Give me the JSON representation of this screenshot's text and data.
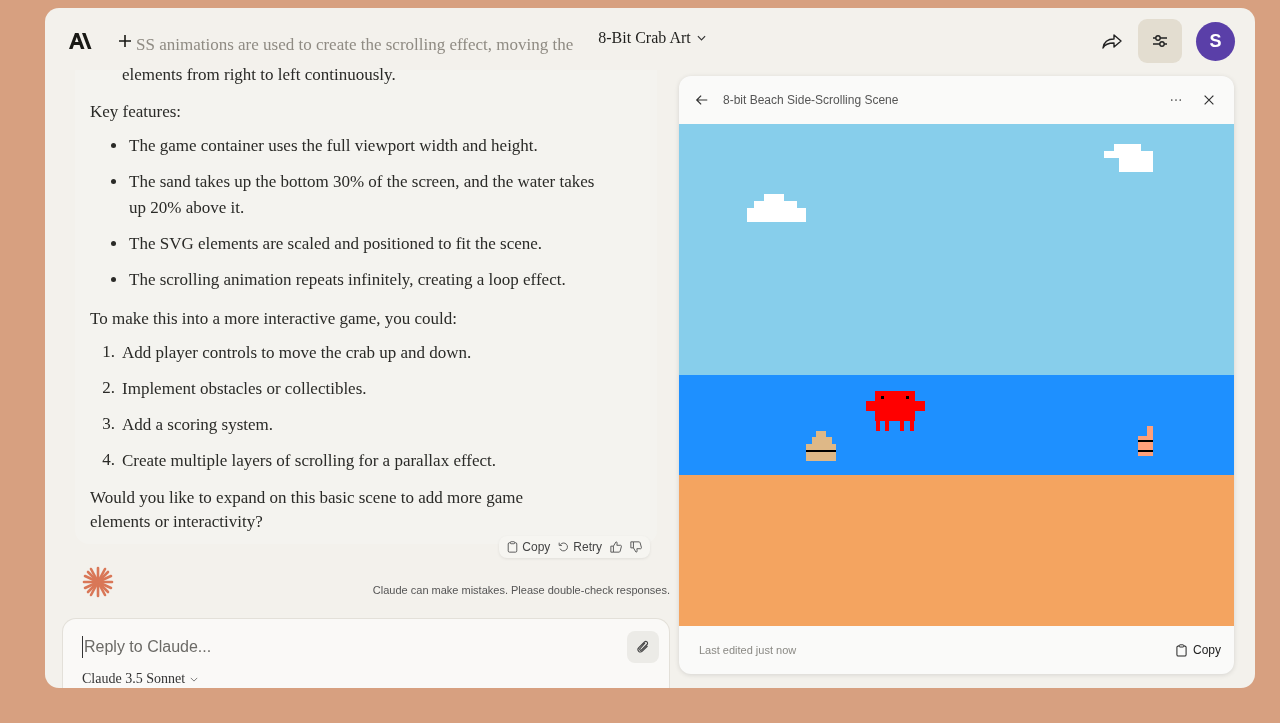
{
  "header": {
    "cut_line": "SS animations are used to create the scrolling effect, moving the",
    "title": "8-Bit Crab Art",
    "avatar": "S"
  },
  "message": {
    "continuation": "elements from right to left continuously.",
    "features_heading": "Key features:",
    "bullets": [
      "The game container uses the full viewport width and height.",
      "The sand takes up the bottom 30% of the screen, and the water takes up 20% above it.",
      "The SVG elements are scaled and positioned to fit the scene.",
      "The scrolling animation repeats infinitely, creating a loop effect."
    ],
    "intro": "To make this into a more interactive game, you could:",
    "steps": [
      {
        "number": "1.",
        "text": "Add player controls to move the crab up and down."
      },
      {
        "number": "2.",
        "text": "Implement obstacles or collectibles."
      },
      {
        "number": "3.",
        "text": "Add a scoring system."
      },
      {
        "number": "4.",
        "text": "Create multiple layers of scrolling for a parallax effect."
      }
    ],
    "closing": "Would you like to expand on this basic scene to add more game elements or interactivity?"
  },
  "actions": [
    {
      "kind": "copy",
      "label": "Copy"
    },
    {
      "kind": "retry",
      "label": "Retry"
    },
    {
      "kind": "thumbs_up"
    },
    {
      "kind": "thumbs_down"
    }
  ],
  "disclaimer": "Claude can make mistakes. Please double-check responses.",
  "composer": {
    "placeholder": "Reply to Claude...",
    "model": "Claude 3.5 Sonnet"
  },
  "artifact": {
    "title": "8-bit Beach Side-Scrolling Scene",
    "footer_text": "Last edited just now",
    "copy_label": "Copy"
  }
}
